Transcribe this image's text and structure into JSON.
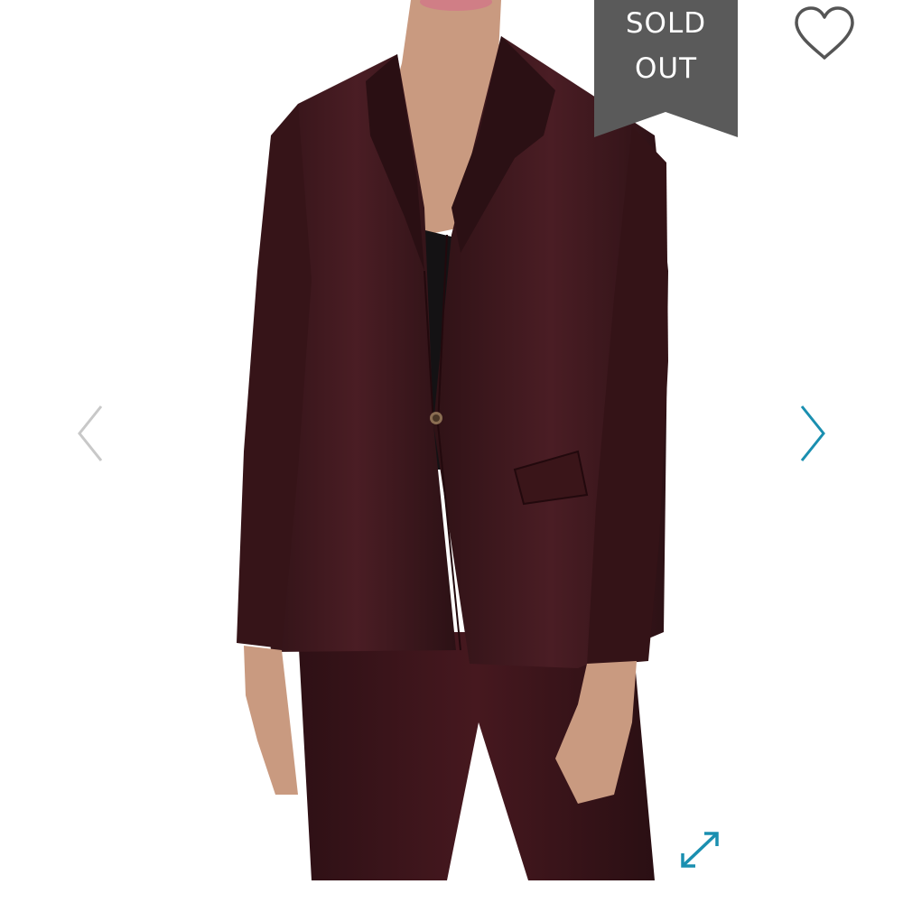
{
  "badge": {
    "line1": "SOLD",
    "line2": "OUT",
    "color": "#5a5a5a"
  },
  "icons": {
    "favorite": "heart-outline-icon",
    "previous": "chevron-left-icon",
    "next": "chevron-right-icon",
    "expand": "expand-arrows-icon"
  },
  "colors": {
    "accent": "#1a8fb0",
    "inactive_arrow": "#c8c8c8",
    "garment": "#3e1a1f"
  }
}
